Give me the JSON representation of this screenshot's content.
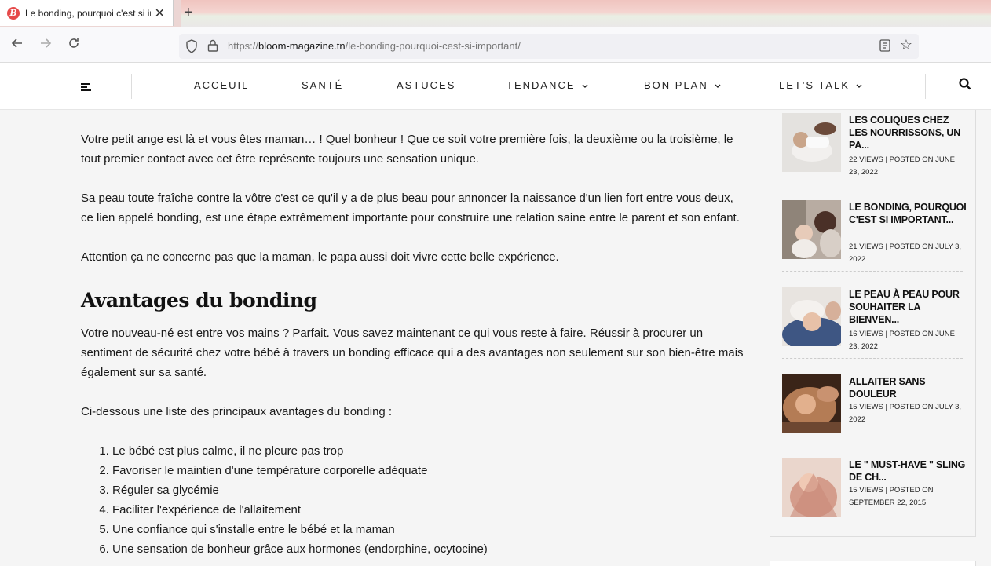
{
  "browser": {
    "tab_title": "Le bonding, pourquoi c'est si important",
    "favicon_letter": "B",
    "new_tab_icon": "plus-icon",
    "url_host": "bloom-magazine.tn",
    "url_scheme": "https://",
    "url_path": "/le-bonding-pourquoi-cest-si-important/"
  },
  "nav": {
    "items": [
      {
        "label": "ACCEUIL",
        "dropdown": false
      },
      {
        "label": "SANTÉ",
        "dropdown": false
      },
      {
        "label": "ASTUCES",
        "dropdown": false
      },
      {
        "label": "TENDANCE",
        "dropdown": true
      },
      {
        "label": "BON PLAN",
        "dropdown": true
      },
      {
        "label": "LET'S TALK",
        "dropdown": true
      }
    ],
    "dropdown_glyph": "⌄"
  },
  "article": {
    "p1": "Votre petit ange est là et vous êtes maman… ! Quel bonheur ! Que ce soit votre première fois, la deuxième ou la troisième, le tout premier contact avec cet être représente toujours une sensation unique.",
    "p2": "Sa peau toute fraîche contre la vôtre c'est ce qu'il y a de plus beau pour annoncer la naissance d'un lien fort entre vous deux, ce lien appelé bonding, est une étape extrêmement importante pour construire  une relation saine entre le parent et son enfant.",
    "p3": "Attention ça ne concerne pas que la maman, le papa aussi doit vivre cette belle expérience.",
    "h2": "Avantages du bonding",
    "p4": "Votre nouveau-né est entre vos mains ? Parfait. Vous savez maintenant ce qui vous reste à faire. Réussir à procurer un sentiment de sécurité chez votre bébé à travers un bonding efficace qui a des avantages non seulement sur son bien-être mais également sur sa santé.",
    "p5": "Ci-dessous une liste des principaux avantages du bonding :",
    "list": [
      "Le bébé est plus calme, il ne pleure pas trop",
      "Favoriser le maintien d'une température corporelle adéquate",
      "Réguler sa glycémie",
      "Faciliter l'expérience de l'allaitement",
      "Une confiance qui s'installe entre le bébé et la maman",
      "Une sensation de bonheur grâce aux hormones (endorphine, ocytocine)"
    ]
  },
  "sidebar": {
    "posts": [
      {
        "title": "LES COLIQUES CHEZ LES NOURRISSONS, UN PA...",
        "meta": "22 VIEWS | POSTED ON JUNE 23, 2022",
        "thumb_color": "#d9d6d2"
      },
      {
        "title": "LE BONDING, POURQUOI C'EST SI IMPORTANT...",
        "meta": "21 VIEWS | POSTED ON JULY 3, 2022",
        "thumb_color": "#a89a8e"
      },
      {
        "title": "LE PEAU À PEAU POUR SOUHAITER LA BIENVEN...",
        "meta": "16 VIEWS | POSTED ON JUNE 23, 2022",
        "thumb_color": "#5a6f93"
      },
      {
        "title": "ALLAITER SANS DOULEUR",
        "meta": "15 VIEWS | POSTED ON JULY 3, 2022",
        "thumb_color": "#9a6a46"
      },
      {
        "title": "LE \" MUST-HAVE \" SLING DE CH...",
        "meta": "15 VIEWS | POSTED ON SEPTEMBER 22, 2015",
        "thumb_color": "#d1a395"
      }
    ]
  }
}
